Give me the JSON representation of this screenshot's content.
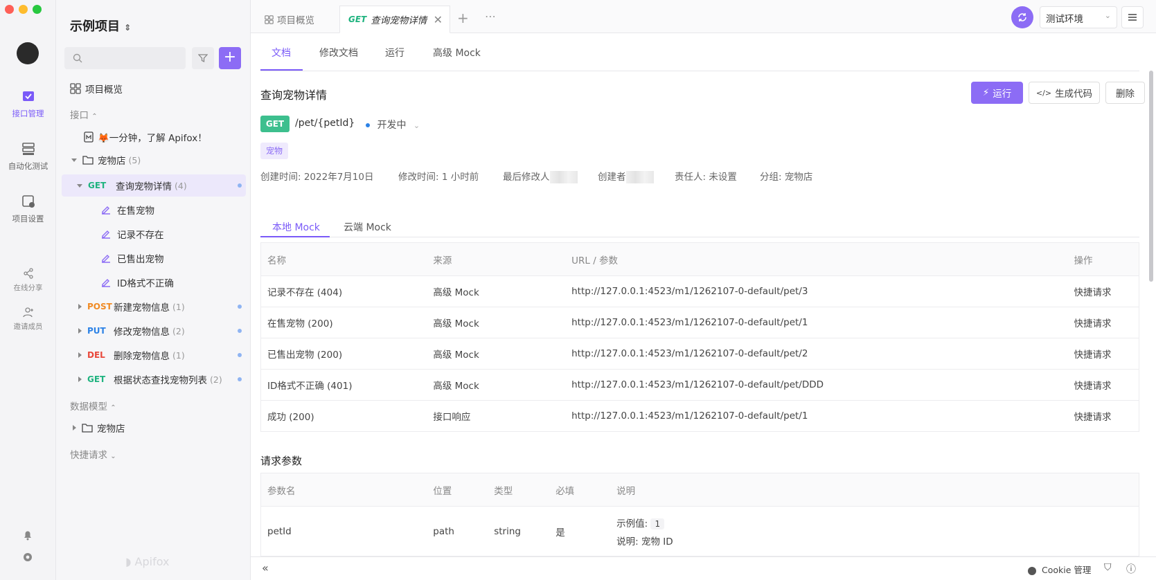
{
  "rail": {
    "items": [
      {
        "label": "接口管理",
        "icon": "api-management-icon"
      },
      {
        "label": "自动化测试",
        "icon": "automation-test-icon"
      },
      {
        "label": "项目设置",
        "icon": "project-settings-icon"
      },
      {
        "label": "在线分享",
        "icon": "share-icon"
      },
      {
        "label": "邀请成员",
        "icon": "invite-member-icon"
      }
    ]
  },
  "sidebar": {
    "project_name": "示例项目",
    "overview": "项目概览",
    "section_api": "接口",
    "intro": "🦊一分钟，了解 Apifox！",
    "folder_name": "宠物店",
    "folder_count": "(5)",
    "apis": [
      {
        "method": "GET",
        "name": "查询宠物详情",
        "count": "(4)"
      },
      {
        "method": "POST",
        "name": "新建宠物信息",
        "count": "(1)"
      },
      {
        "method": "PUT",
        "name": "修改宠物信息",
        "count": "(2)"
      },
      {
        "method": "DEL",
        "name": "删除宠物信息",
        "count": "(1)"
      },
      {
        "method": "GET",
        "name": "根据状态查找宠物列表",
        "count": "(2)"
      }
    ],
    "cases": [
      "在售宠物",
      "记录不存在",
      "已售出宠物",
      "ID格式不正确"
    ],
    "section_models": "数据模型",
    "model_folder": "宠物店",
    "section_quick": "快捷请求",
    "watermark": "Apifox"
  },
  "tabs": {
    "overview": "项目概览",
    "active_method": "GET",
    "active_name": "查询宠物详情",
    "env": "测试环境"
  },
  "subtabs": [
    "文档",
    "修改文档",
    "运行",
    "高级 Mock"
  ],
  "doc": {
    "title": "查询宠物详情",
    "run": "运行",
    "gen_code": "生成代码",
    "delete": "删除",
    "method": "GET",
    "path": "/pet/{petId}",
    "status": "开发中",
    "tag": "宠物",
    "created": "创建时间: 2022年7月10日",
    "modified": "修改时间: 1 小时前",
    "last_modifier": "最后修改人",
    "creator": "创建者",
    "owner": "责任人: 未设置",
    "group": "分组: 宠物店"
  },
  "mock_tabs": [
    "本地 Mock",
    "云端 Mock"
  ],
  "mock_table": {
    "headers": [
      "名称",
      "来源",
      "URL / 参数",
      "操作"
    ],
    "rows": [
      {
        "name": "记录不存在 (404)",
        "source": "高级 Mock",
        "url": "http://127.0.0.1:4523/m1/1262107-0-default/pet/3",
        "action": "快捷请求"
      },
      {
        "name": "在售宠物 (200)",
        "source": "高级 Mock",
        "url": "http://127.0.0.1:4523/m1/1262107-0-default/pet/1",
        "action": "快捷请求"
      },
      {
        "name": "已售出宠物 (200)",
        "source": "高级 Mock",
        "url": "http://127.0.0.1:4523/m1/1262107-0-default/pet/2",
        "action": "快捷请求"
      },
      {
        "name": "ID格式不正确 (401)",
        "source": "高级 Mock",
        "url": "http://127.0.0.1:4523/m1/1262107-0-default/pet/DDD",
        "action": "快捷请求"
      },
      {
        "name": "成功 (200)",
        "source": "接口响应",
        "url": "http://127.0.0.1:4523/m1/1262107-0-default/pet/1",
        "action": "快捷请求"
      }
    ]
  },
  "params": {
    "title": "请求参数",
    "headers": [
      "参数名",
      "位置",
      "类型",
      "必填",
      "说明"
    ],
    "row": {
      "name": "petId",
      "in": "path",
      "type": "string",
      "required": "是",
      "example_label": "示例值:",
      "example": "1",
      "desc_label": "说明:",
      "desc": "宠物 ID"
    }
  },
  "footer": {
    "cookie": "Cookie 管理"
  },
  "colors": {
    "accent": "#7a5af8",
    "get": "#1fb37f",
    "post": "#f08a24",
    "put": "#2c82e6",
    "del": "#e8483b"
  }
}
